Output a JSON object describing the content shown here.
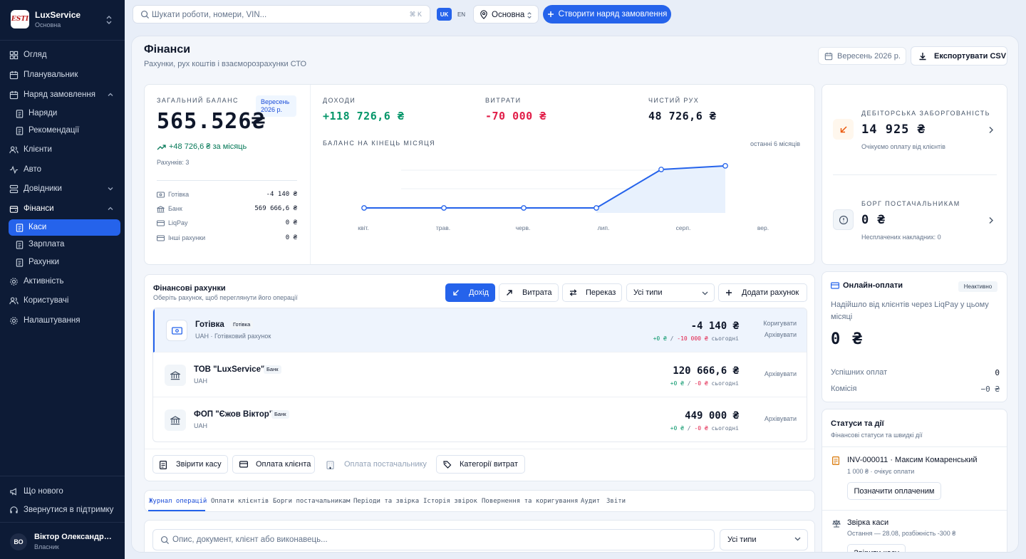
{
  "app": {
    "name": "LuxService",
    "branch": "Основна",
    "logo_text": "ESTI"
  },
  "sidebar": {
    "items": [
      {
        "label": "Огляд",
        "icon": "grid-icon"
      },
      {
        "label": "Планувальник",
        "icon": "calendar-icon"
      },
      {
        "label": "Наряд замовлення",
        "icon": "calendar-icon",
        "expanded": true
      },
      {
        "label": "Наряди",
        "icon": "clipboard-icon"
      },
      {
        "label": "Рекомендації",
        "icon": "clipboard-icon"
      },
      {
        "label": "Клієнти",
        "icon": "users-icon"
      },
      {
        "label": "Авто",
        "icon": "activity-icon"
      },
      {
        "label": "Довідники",
        "icon": "layers-icon"
      },
      {
        "label": "Фінанси",
        "icon": "wallet-icon",
        "expanded": true
      },
      {
        "label": "Каси",
        "icon": "clipboard-icon",
        "active": true
      },
      {
        "label": "Зарплата",
        "icon": "clipboard-icon"
      },
      {
        "label": "Рахунки",
        "icon": "clipboard-icon"
      },
      {
        "label": "Активність",
        "icon": "gear-icon"
      },
      {
        "label": "Користувачі",
        "icon": "users-icon"
      },
      {
        "label": "Налаштування",
        "icon": "gear-icon"
      }
    ],
    "footer": [
      {
        "label": "Що нового",
        "icon": "megaphone-icon"
      },
      {
        "label": "Звернутися в підтримку",
        "icon": "headset-icon"
      }
    ],
    "user": {
      "initials": "ВО",
      "name": "Віктор Олександров...",
      "role": "Власник"
    }
  },
  "topbar": {
    "search_placeholder": "Шукати роботи, номери, VIN...",
    "shortcut": "⌘ K",
    "lang_active": "UK",
    "lang_other": "EN",
    "branch": "Основна",
    "create_button": "Створити наряд замовлення"
  },
  "page": {
    "title": "Фінанси",
    "subtitle": "Рахунки, рух коштів і взаєморозрахунки СТО",
    "period": "Вересень 2026 р.",
    "export_label": "Експортувати CSV"
  },
  "balance": {
    "caption": "Загальний баланс",
    "period_badge_line1": "Вересень",
    "period_badge_line2": "2026 р.",
    "amount": "565.526₴",
    "delta": "+48 726,6 ₴ за місяць",
    "accounts_count": "Рахунків: 3",
    "breakdown": [
      {
        "name": "Готівка",
        "value": "-4 140 ₴",
        "icon": "cash-icon"
      },
      {
        "name": "Банк",
        "value": "569 666,6 ₴",
        "icon": "bank-icon"
      },
      {
        "name": "LiqPay",
        "value": "0 ₴",
        "icon": "card-icon"
      },
      {
        "name": "Інші рахунки",
        "value": "0 ₴",
        "icon": "card-icon"
      }
    ]
  },
  "kpis": [
    {
      "caption": "Доходи",
      "value": "+118 726,6 ₴",
      "tone": "pos"
    },
    {
      "caption": "Витрати",
      "value": "-70 000 ₴",
      "tone": "neg"
    },
    {
      "caption": "Чистий рух",
      "value": "48 726,6 ₴",
      "tone": "neutral"
    }
  ],
  "chart_meta": {
    "caption": "Баланс на кінець місяця",
    "note": "останні 6 місяців",
    "line_color": "#2563eb",
    "fill_color": "#e8f1fd"
  },
  "chart_data": {
    "type": "area",
    "title": "Баланс на кінець місяця",
    "categories": [
      "квіт.",
      "трав.",
      "черв.",
      "лип.",
      "серп.",
      "вер."
    ],
    "points": [
      {
        "label": "квіт.",
        "value": 0
      },
      {
        "label": "трав.",
        "value": 0
      },
      {
        "label": "черв.",
        "value": 0
      },
      {
        "label": "лип.",
        "value": 0
      },
      {
        "label": "серп.",
        "value": 516800
      },
      {
        "label": "вер.",
        "value": 565526.6
      }
    ],
    "ylim": [
      0,
      620000
    ],
    "grid": true,
    "legend": "none"
  },
  "receivables": {
    "caption": "Дебіторська заборгованість",
    "value": "14 925 ₴",
    "sub": "Очікуємо оплату від клієнтів",
    "icon": "arrow-down-left-icon",
    "accent": "#ea580c"
  },
  "payables": {
    "caption": "Борг постачальникам",
    "value": "0 ₴",
    "sub": "Несплачених накладних: 0",
    "icon": "alert-circle-icon"
  },
  "online": {
    "title": "Онлайн-оплати",
    "badge": "Неактивно",
    "desc": "Надійшло від клієнтів через LiqPay у цьому місяці",
    "value": "0 ₴",
    "rows": [
      {
        "label": "Успішних оплат",
        "value": "0"
      },
      {
        "label": "Комісія",
        "value": "−0 ₴"
      }
    ]
  },
  "statuses": {
    "title": "Статуси та дії",
    "sub": "Фінансові статуси та швидкі дії",
    "items": [
      {
        "title": "INV-000011 · Максим Комаренський",
        "sub": "1 000 ₴ · очікує оплати",
        "action": "Позначити оплаченим",
        "icon": "invoice-icon"
      },
      {
        "title": "Звірка каси",
        "sub": "Остання — 28.08, розбіжність -300 ₴",
        "action": "Звірити касу",
        "icon": "scale-icon"
      }
    ]
  },
  "accounts": {
    "title": "Фінансові рахунки",
    "sub": "Оберіть рахунок, щоб переглянути його операції",
    "buttons": {
      "income": "Дохід",
      "expense": "Витрата",
      "transfer": "Переказ",
      "type_filter": "Усі типи",
      "add": "Додати рахунок"
    },
    "rows": [
      {
        "name": "Готівка",
        "tag": "Готівка",
        "desc": "UAH · Готівковий рахунок",
        "amount": "-4 140 ₴",
        "in": "+0 ₴",
        "out": "-10 000 ₴",
        "today": "сьогодні",
        "actions": [
          "Коригувати",
          "Архівувати"
        ],
        "icon": "cash-icon",
        "selected": true
      },
      {
        "name": "ТОВ \"LuxService\"",
        "tag": "Банк",
        "desc": "UAH",
        "amount": "120 666,6 ₴",
        "in": "+0 ₴",
        "out": "-0 ₴",
        "today": "сьогодні",
        "actions": [
          "Архівувати"
        ],
        "icon": "bank-icon",
        "selected": false
      },
      {
        "name": "ФОП \"Єжов Віктор\"",
        "tag": "Банк",
        "desc": "UAH",
        "amount": "449 000 ₴",
        "in": "+0 ₴",
        "out": "-0 ₴",
        "today": "сьогодні",
        "actions": [
          "Архівувати"
        ],
        "icon": "bank-icon",
        "selected": false
      }
    ],
    "footer_buttons": [
      {
        "label": "Звірити касу",
        "icon": "receipt-icon",
        "disabled": false
      },
      {
        "label": "Оплата клієнта",
        "icon": "card-icon",
        "disabled": false
      },
      {
        "label": "Оплата постачальнику",
        "icon": "building-icon",
        "disabled": true
      },
      {
        "label": "Категорії витрат",
        "icon": "tags-icon",
        "disabled": false
      }
    ]
  },
  "tabs": [
    "Журнал операцій",
    "Оплати клієнтів",
    "Борги постачальникам",
    "Періоди та звірка",
    "Історія звірок",
    "Повернення та коригування",
    "Аудит",
    "Звіти"
  ],
  "filter": {
    "placeholder": "Опис, документ, клієнт або виконавець...",
    "type": "Усі типи"
  }
}
